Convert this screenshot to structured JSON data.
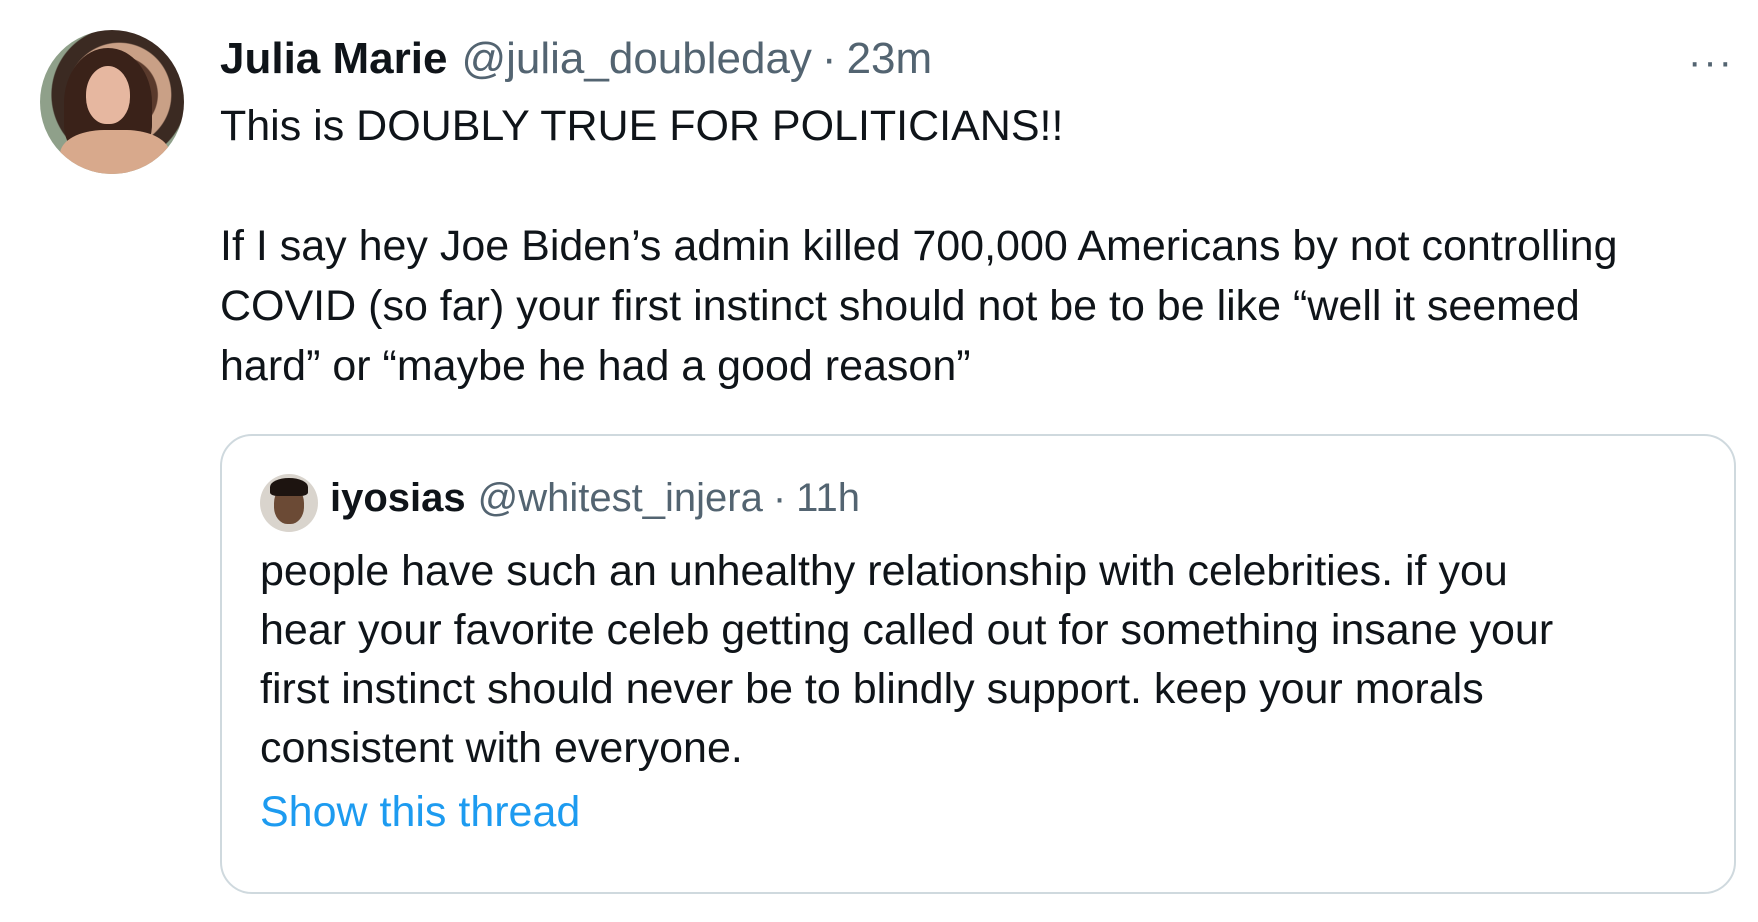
{
  "tweet": {
    "author_name": "Julia Marie",
    "author_handle": "@julia_doubleday",
    "separator": "·",
    "time": "23m",
    "more_icon": "···",
    "text": "This is DOUBLY TRUE FOR POLITICIANS!!\n\nIf I say hey Joe Biden’s admin killed 700,000 Americans by not controlling\nCOVID (so far) your first instinct should not be to be like “well it seemed\nhard” or “maybe he had a good reason”"
  },
  "quoted_tweet": {
    "author_name": "iyosias",
    "author_handle": "@whitest_injera",
    "separator": "·",
    "time": "11h",
    "text": "people have such an unhealthy relationship with celebrities. if you\nhear your favorite celeb getting called out for something insane your\nfirst instinct should never be to blindly support. keep your morals\nconsistent with everyone.",
    "show_thread_label": "Show this thread"
  },
  "colors": {
    "text": "#0f1419",
    "secondary": "#536471",
    "link": "#1d9bf0",
    "border": "#cfd9de"
  }
}
